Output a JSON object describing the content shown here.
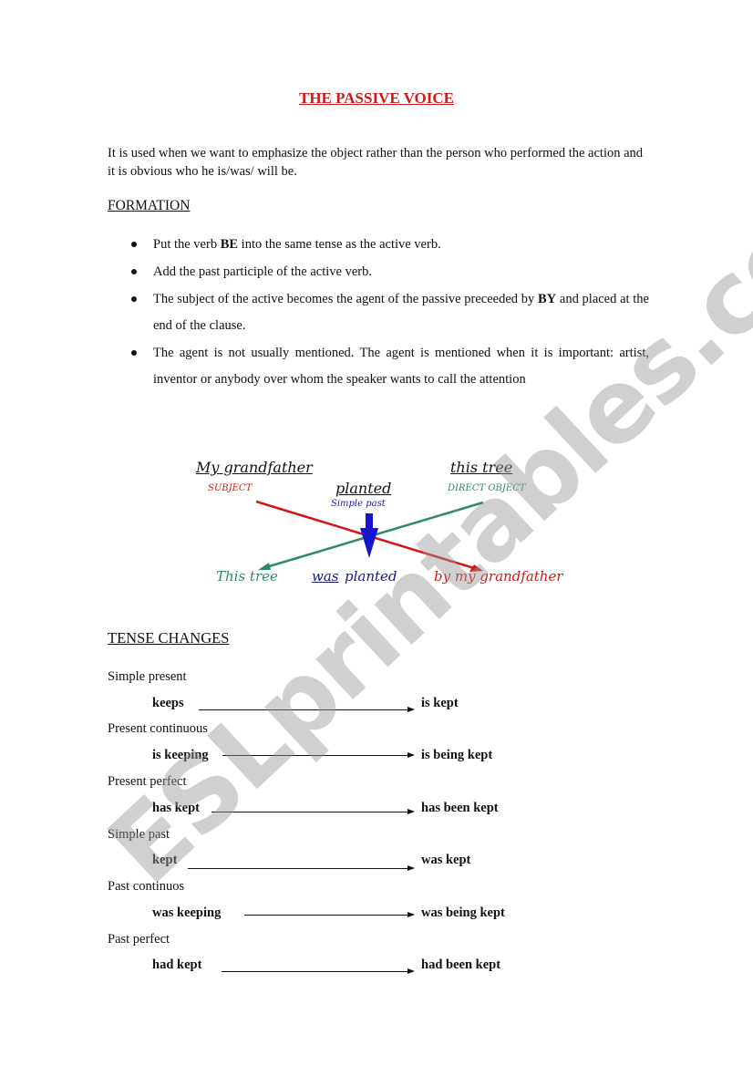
{
  "title": "THE PASSIVE VOICE",
  "intro": "It is used when we want to emphasize the object rather than the person who performed the action and it is obvious who he is/was/ will be.",
  "formation": {
    "heading": "FORMATION",
    "bullets": [
      {
        "before": "Put the verb ",
        "bold": "BE",
        "after": " into the same tense as the active verb."
      },
      {
        "before": "Add the past participle of the active verb.",
        "bold": "",
        "after": ""
      },
      {
        "before": "The subject of the active becomes the agent of the passive preceeded by ",
        "bold": "BY",
        "after": " and placed at the end of the clause."
      },
      {
        "before": "The agent is not usually mentioned. The agent is mentioned when it is important: artist, inventor or anybody over whom the speaker wants to call the attention",
        "bold": "",
        "after": ""
      }
    ]
  },
  "diagram": {
    "subject_phrase": "My grandfather",
    "subject_label": "SUBJECT",
    "verb": "planted",
    "verb_label": "Simple past",
    "object_phrase": "this tree",
    "object_label": "DIRECT OBJECT",
    "passive_subject": "This tree",
    "passive_aux": "was",
    "passive_verb": "planted",
    "passive_agent": "by my grandfather",
    "colors": {
      "red": "#d01818",
      "green": "#2e8b64",
      "blue": "#1515cc",
      "navy": "#1a1a8c"
    }
  },
  "tense_changes": {
    "heading": "TENSE CHANGES",
    "rows": [
      {
        "tense": "Simple present",
        "active": "keeps",
        "passive": "is kept"
      },
      {
        "tense": "Present continuous",
        "active": "is keeping",
        "passive": "is being kept"
      },
      {
        "tense": "Present perfect",
        "active": "has kept",
        "passive": "has been kept"
      },
      {
        "tense": "Simple past",
        "active": "kept",
        "passive": "was kept"
      },
      {
        "tense": "Past continuos",
        "active": "was keeping",
        "passive": "was being kept"
      },
      {
        "tense": "Past perfect",
        "active": "had kept",
        "passive": "had been kept"
      }
    ]
  },
  "watermark": "ESLprintables.com"
}
